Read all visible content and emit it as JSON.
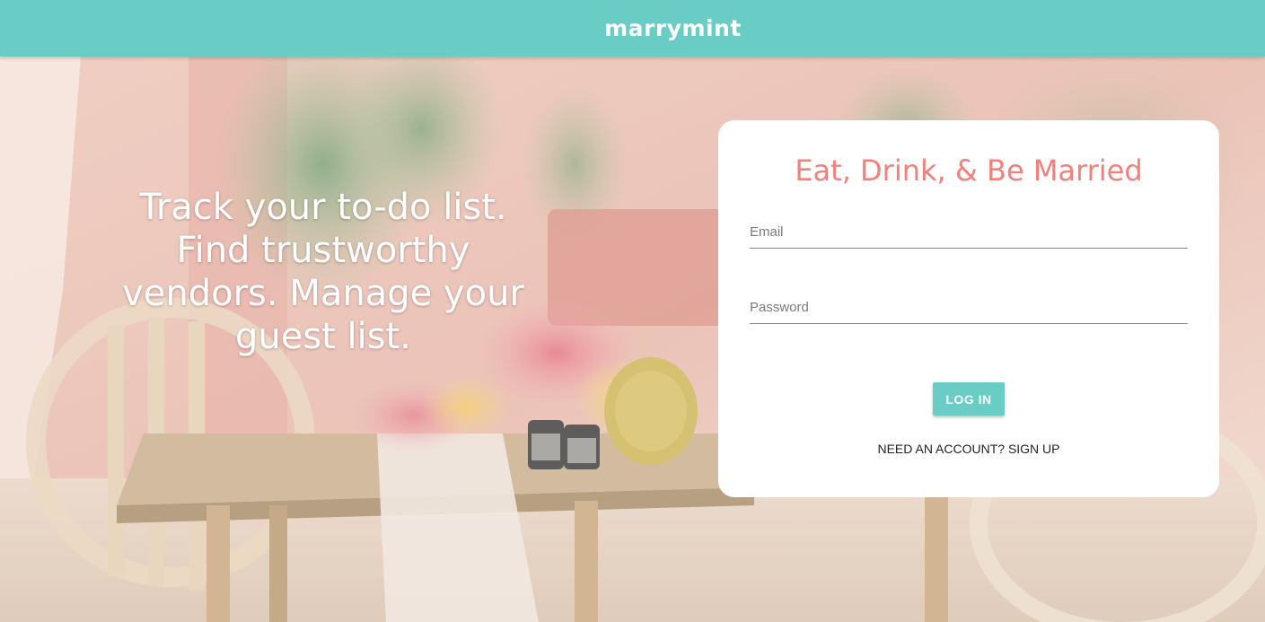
{
  "header": {
    "brand": "marrymint",
    "background_color": "#69cdc6"
  },
  "hero": {
    "tagline": "Track your to-do list. Find trustworthy vendors. Manage your guest list."
  },
  "login_card": {
    "title": "Eat, Drink, & Be Married",
    "title_color": "#f2807b",
    "email_placeholder": "Email",
    "email_value": "",
    "password_placeholder": "Password",
    "password_value": "",
    "login_label": "LOG IN",
    "signup_label": "NEED AN ACCOUNT? SIGN UP"
  }
}
